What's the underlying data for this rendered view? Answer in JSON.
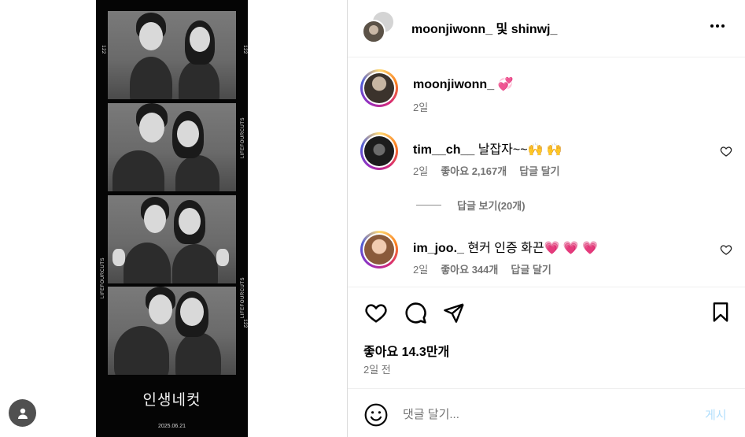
{
  "header": {
    "title": "moonjiwonn_ 및 shinwj_"
  },
  "strip": {
    "title": "인생네컷",
    "date": "2025.06.21",
    "side_brand": "LIFEFOURCUTS",
    "side_number": "122"
  },
  "caption": {
    "username": "moonjiwonn_",
    "text": "💞",
    "time": "2일"
  },
  "comments": [
    {
      "username": "tim__ch__",
      "text": "날잡자~~🙌 🙌",
      "time": "2일",
      "likes": "좋아요 2,167개",
      "reply": "답글 달기"
    },
    {
      "username": "im_joo._",
      "text": "현커 인증 화끈💗 💗 💗",
      "time": "2일",
      "likes": "좋아요 344개",
      "reply": "답글 달기"
    }
  ],
  "view_replies": "답글 보기(20개)",
  "likes_total": "좋아요 14.3만개",
  "posted_ago": "2일 전",
  "composer": {
    "placeholder": "댓글 달기...",
    "post_label": "게시"
  },
  "icons": {
    "like": "heart-icon",
    "comment": "comment-icon",
    "share": "send-icon",
    "save": "bookmark-icon",
    "emoji": "emoji-icon",
    "more": "more-icon",
    "account": "user-icon"
  },
  "colors": {
    "post_button_disabled": "#b2dffc",
    "secondary_text": "#737373",
    "story_ring": "#d62976"
  }
}
